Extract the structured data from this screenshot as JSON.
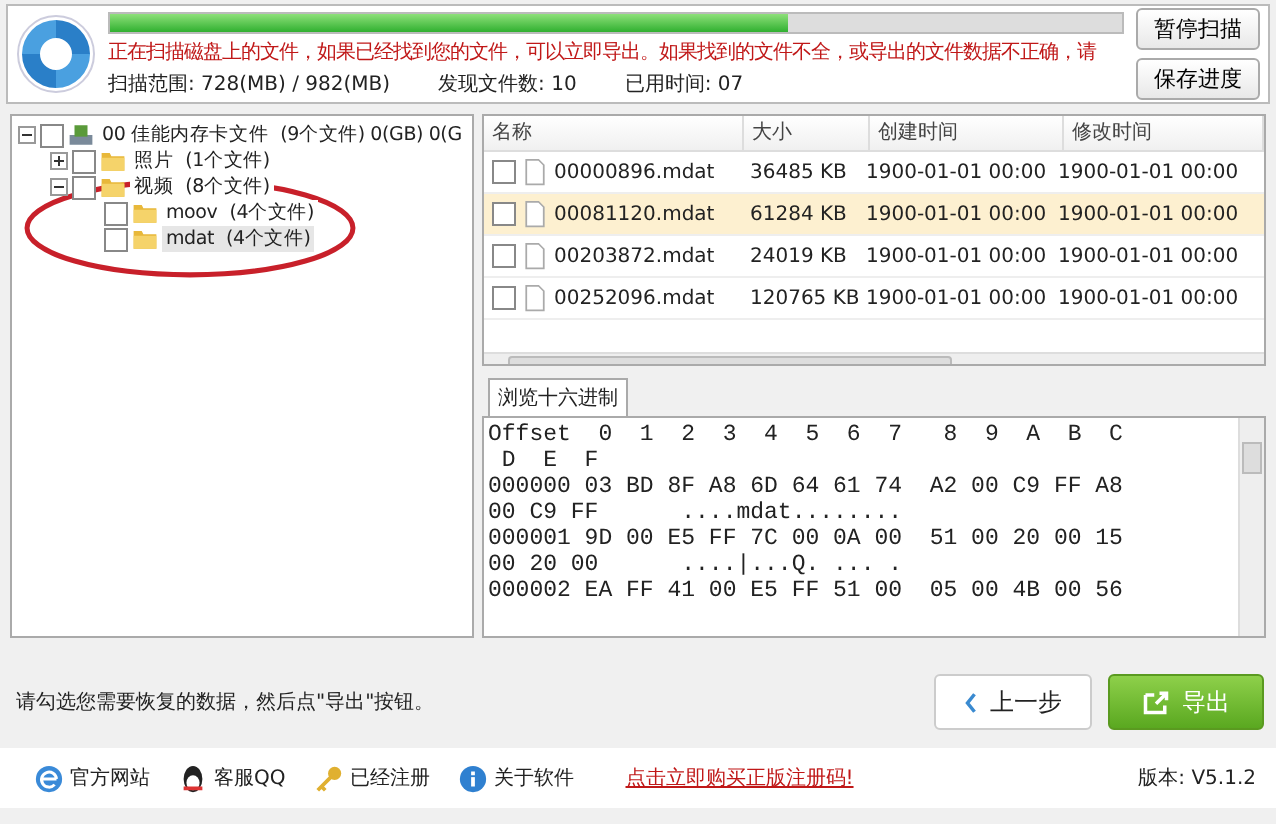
{
  "header": {
    "progress": {
      "level": 0.67
    },
    "message": "正在扫描磁盘上的文件，如果已经找到您的文件，可以立即导出。如果找到的文件不全，或导出的文件数据不正确，请",
    "stats": [
      {
        "label": "扫描范围:",
        "value": "728(MB) / 982(MB)"
      },
      {
        "label": "发现文件数:",
        "value": "10"
      },
      {
        "label": "已用时间:",
        "value": "07"
      }
    ],
    "buttons": [
      "暂停扫描",
      "保存进度"
    ]
  },
  "tree": [
    {
      "name": "00  佳能内存卡文件",
      "count": "(9个文件) 0(GB) 0(G",
      "kind": "drive",
      "expanded": true,
      "checked": false,
      "selected": false,
      "children": [
        {
          "name": "照片",
          "count": "(1个文件)",
          "kind": "folder",
          "expanded": false,
          "checked": false,
          "selected": false
        },
        {
          "name": "视频",
          "count": "(8个文件)",
          "kind": "folder",
          "expanded": true,
          "checked": false,
          "selected": false,
          "children": [
            {
              "name": "moov",
              "count": "(4个文件)",
              "kind": "folder",
              "checked": false,
              "selected": false
            },
            {
              "name": "mdat",
              "count": "(4个文件)",
              "kind": "folder",
              "checked": false,
              "selected": true
            }
          ]
        }
      ]
    }
  ],
  "table": {
    "columns": [
      "名称",
      "大小",
      "创建时间",
      "修改时间"
    ],
    "rows": [
      {
        "name": "00000896.mdat",
        "size": "36485 KB",
        "created": "1900-01-01  00:00",
        "modified": "1900-01-01  00:00",
        "checked": false,
        "selected": false
      },
      {
        "name": "00081120.mdat",
        "size": "61284 KB",
        "created": "1900-01-01  00:00",
        "modified": "1900-01-01  00:00",
        "checked": false,
        "selected": true
      },
      {
        "name": "00203872.mdat",
        "size": "24019 KB",
        "created": "1900-01-01  00:00",
        "modified": "1900-01-01  00:00",
        "checked": false,
        "selected": false
      },
      {
        "name": "00252096.mdat",
        "size": "120765 KB",
        "created": "1900-01-01  00:00",
        "modified": "1900-01-01  00:00",
        "checked": false,
        "selected": false
      }
    ]
  },
  "hex_view": {
    "tabs": [
      {
        "label": "浏览十六进制",
        "selected": true
      }
    ],
    "lines": [
      "Offset  0  1  2  3  4  5  6  7   8  9  A  B  C",
      " D  E  F",
      "000000 03 BD 8F A8 6D 64 61 74  A2 00 C9 FF A8",
      "00 C9 FF      ....mdat........",
      "000001 9D 00 E5 FF 7C 00 0A 00  51 00 20 00 15",
      "00 20 00      ....|...Q. ... .",
      "000002 EA FF 41 00 E5 FF 51 00  05 00 4B 00 56"
    ]
  },
  "hint": "请勾选您需要恢复的数据，然后点\"导出\"按钮。",
  "nav_buttons": [
    {
      "label": "上一步",
      "kind": "back"
    },
    {
      "label": "导出",
      "kind": "export"
    }
  ],
  "footer": {
    "links": [
      {
        "label": "官方网站",
        "kind": "web"
      },
      {
        "label": "客服QQ",
        "kind": "qq"
      },
      {
        "label": "已经注册",
        "kind": "key"
      },
      {
        "label": "关于软件",
        "kind": "info"
      }
    ],
    "promo": "点击立即购买正版注册码!",
    "version_label": "版本:",
    "version": "V5.1.2"
  }
}
